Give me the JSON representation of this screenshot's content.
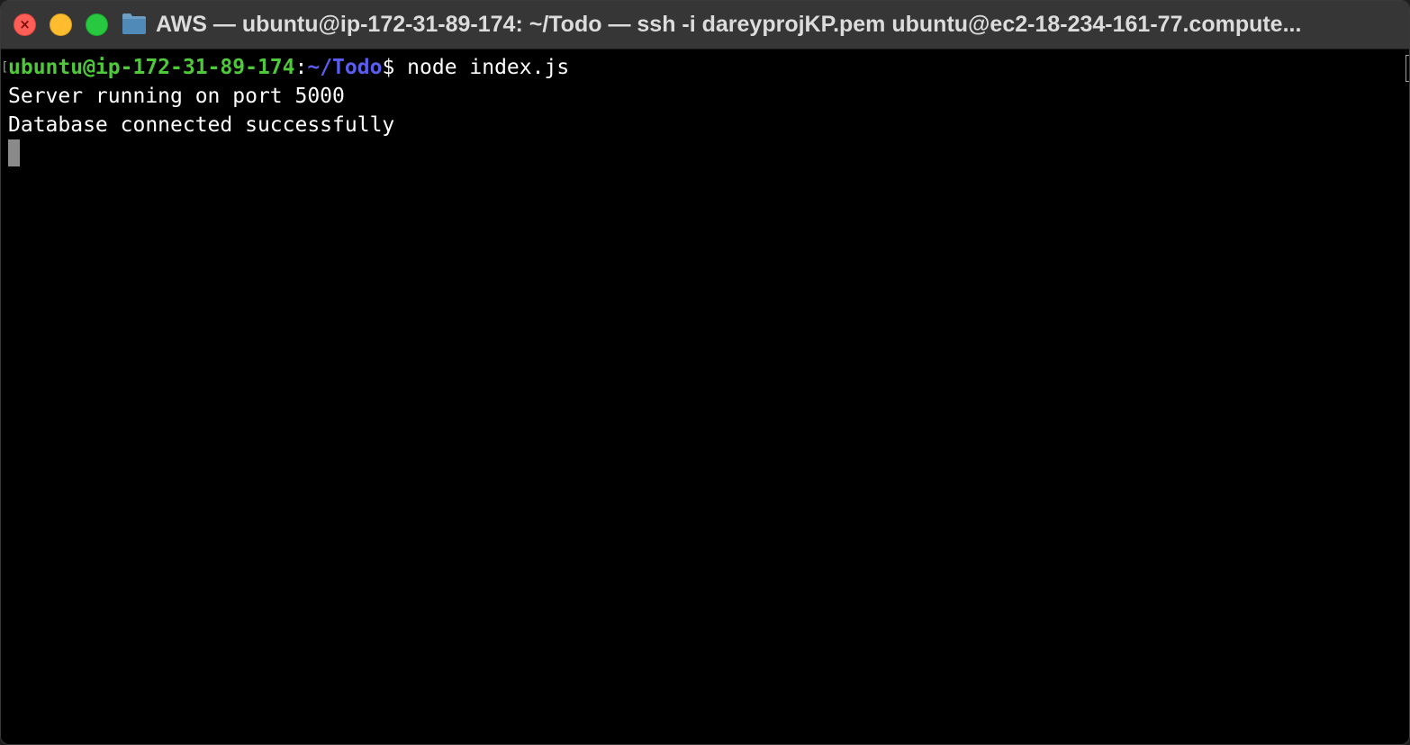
{
  "window": {
    "title": "AWS — ubuntu@ip-172-31-89-174: ~/Todo — ssh -i dareyprojKP.pem ubuntu@ec2-18-234-161-77.compute...",
    "close_glyph": "×",
    "icons": {
      "close": "close-icon",
      "minimize": "minimize-icon",
      "zoom": "zoom-icon",
      "folder": "folder-icon"
    }
  },
  "terminal": {
    "prompt_user_host": "ubuntu@ip-172-31-89-174",
    "prompt_sep": ":",
    "prompt_path": "~/Todo",
    "prompt_symbol": "$ ",
    "command": "node index.js",
    "output": [
      "Server running on port 5000",
      "Database connected successfully"
    ]
  },
  "colors": {
    "user_host": "#4ec93a",
    "path": "#5a5ef0",
    "text": "#ffffff",
    "background": "#000000",
    "titlebar": "#363636"
  }
}
